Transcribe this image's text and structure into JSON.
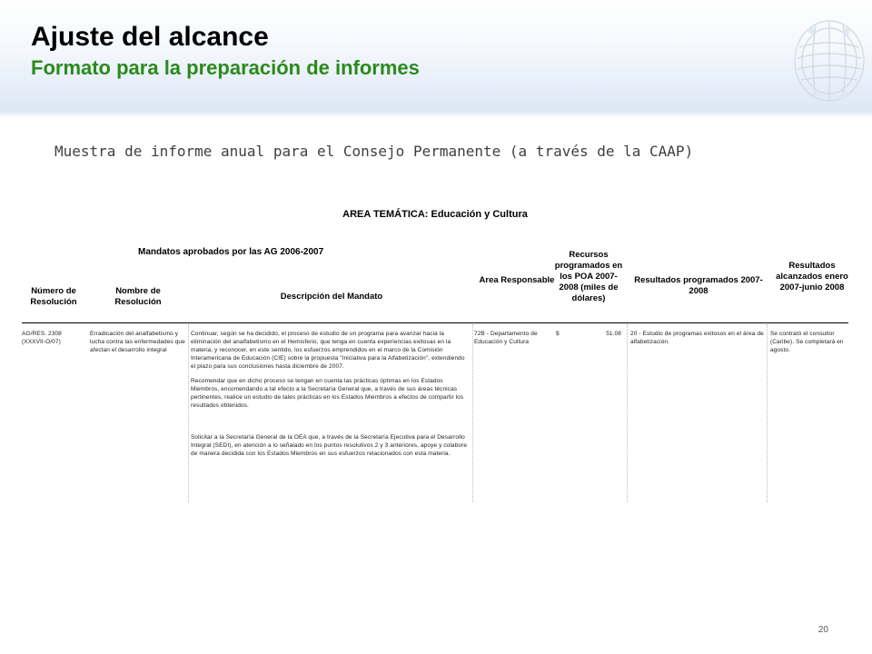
{
  "slide": {
    "title": "Ajuste del alcance",
    "subtitle": "Formato para la preparación de informes",
    "intro": "Muestra de informe anual para el Consejo Permanente (a través de la CAAP)",
    "page_number": "20",
    "colors": {
      "title": "#000000",
      "subtitle": "#2b8a1c",
      "header_band": "#d9e6f5"
    }
  },
  "report": {
    "title": "AREA TEMÁTICA: Educación y Cultura",
    "mandatos_label": "Mandatos aprobados por las AG 2006-2007",
    "headers": {
      "numero": "Número de Resolución",
      "nombre": "Nombre de Resolución",
      "descripcion": "Descripción del Mandato",
      "area": "Area Responsable",
      "recursos": "Recursos programados en los POA 2007-2008 (miles de dólares)",
      "resultados_prog": "Resultados programados 2007-2008",
      "resultados_alc": "Resultados alcanzados enero 2007-junio 2008"
    },
    "row": {
      "numero": "AG/RES. 2308 (XXXVII-O/07)",
      "nombre": "Erradicación del analfabetismo y lucha contra las enfermedades que afectan el desarrollo integral",
      "descripcion": [
        "Continuar, según se ha decidido, el proceso de estudio de un programa para avanzar hacia la eliminación del analfabetismo en el Hemisferio, que tenga en cuenta experiencias exitosas en la materia, y reconocer, en este sentido, los esfuerzos emprendidos en el marco de la Comisión Interamericana de Educación (CIE) sobre la propuesta \"Iniciativa para la Alfabetización\", extendiendo el plazo para sus conclusiones hasta diciembre de 2007.",
        "Recomendar que en dicho proceso se tengan en cuenta las prácticas óptimas en los Estados Miembros, encomendando a tal efecto a la Secretaría General que, a través de sus áreas técnicas pertinentes, realice un estudio de tales prácticas en los Estados Miembros a efectos de compartir los resultados obtenidos.",
        "Solicitar a la Secretaría General de la OEA que, a través de la Secretaría Ejecutiva para el Desarrollo Integral (SEDI), en atención a lo señalado en los puntos resolutivos 2 y 3 anteriores, apoye y colabore de manera decidida con los Estados Miembros en sus esfuerzos relacionados con esta materia."
      ],
      "area": "72B - Departamento de Educación y Cultura",
      "currency": "$",
      "recursos": "51.08",
      "resultados_prog": "20 - Estudio de programas exitosos en el área de alfabetización.",
      "resultados_alc": "Se contrató el consultor (Caribe). Se completará en agosto."
    }
  }
}
